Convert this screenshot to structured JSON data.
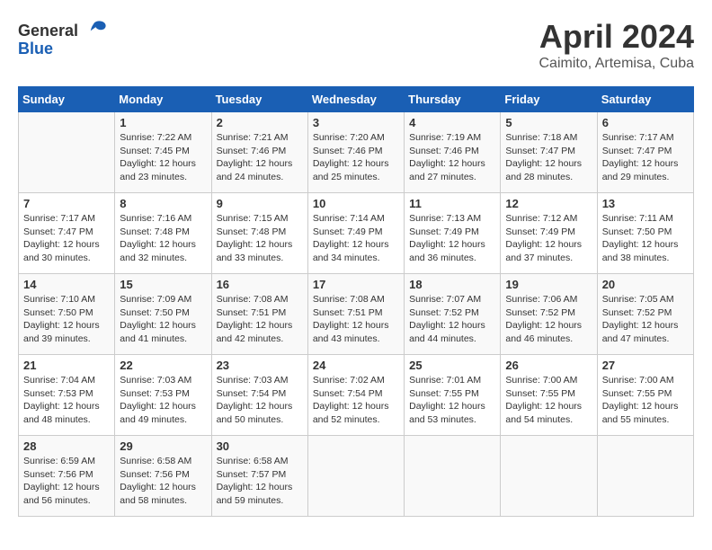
{
  "header": {
    "logo_general": "General",
    "logo_blue": "Blue",
    "month": "April 2024",
    "location": "Caimito, Artemisa, Cuba"
  },
  "calendar": {
    "days_of_week": [
      "Sunday",
      "Monday",
      "Tuesday",
      "Wednesday",
      "Thursday",
      "Friday",
      "Saturday"
    ],
    "weeks": [
      [
        {
          "day": "",
          "info": ""
        },
        {
          "day": "1",
          "info": "Sunrise: 7:22 AM\nSunset: 7:45 PM\nDaylight: 12 hours\nand 23 minutes."
        },
        {
          "day": "2",
          "info": "Sunrise: 7:21 AM\nSunset: 7:46 PM\nDaylight: 12 hours\nand 24 minutes."
        },
        {
          "day": "3",
          "info": "Sunrise: 7:20 AM\nSunset: 7:46 PM\nDaylight: 12 hours\nand 25 minutes."
        },
        {
          "day": "4",
          "info": "Sunrise: 7:19 AM\nSunset: 7:46 PM\nDaylight: 12 hours\nand 27 minutes."
        },
        {
          "day": "5",
          "info": "Sunrise: 7:18 AM\nSunset: 7:47 PM\nDaylight: 12 hours\nand 28 minutes."
        },
        {
          "day": "6",
          "info": "Sunrise: 7:17 AM\nSunset: 7:47 PM\nDaylight: 12 hours\nand 29 minutes."
        }
      ],
      [
        {
          "day": "7",
          "info": "Sunrise: 7:17 AM\nSunset: 7:47 PM\nDaylight: 12 hours\nand 30 minutes."
        },
        {
          "day": "8",
          "info": "Sunrise: 7:16 AM\nSunset: 7:48 PM\nDaylight: 12 hours\nand 32 minutes."
        },
        {
          "day": "9",
          "info": "Sunrise: 7:15 AM\nSunset: 7:48 PM\nDaylight: 12 hours\nand 33 minutes."
        },
        {
          "day": "10",
          "info": "Sunrise: 7:14 AM\nSunset: 7:49 PM\nDaylight: 12 hours\nand 34 minutes."
        },
        {
          "day": "11",
          "info": "Sunrise: 7:13 AM\nSunset: 7:49 PM\nDaylight: 12 hours\nand 36 minutes."
        },
        {
          "day": "12",
          "info": "Sunrise: 7:12 AM\nSunset: 7:49 PM\nDaylight: 12 hours\nand 37 minutes."
        },
        {
          "day": "13",
          "info": "Sunrise: 7:11 AM\nSunset: 7:50 PM\nDaylight: 12 hours\nand 38 minutes."
        }
      ],
      [
        {
          "day": "14",
          "info": "Sunrise: 7:10 AM\nSunset: 7:50 PM\nDaylight: 12 hours\nand 39 minutes."
        },
        {
          "day": "15",
          "info": "Sunrise: 7:09 AM\nSunset: 7:50 PM\nDaylight: 12 hours\nand 41 minutes."
        },
        {
          "day": "16",
          "info": "Sunrise: 7:08 AM\nSunset: 7:51 PM\nDaylight: 12 hours\nand 42 minutes."
        },
        {
          "day": "17",
          "info": "Sunrise: 7:08 AM\nSunset: 7:51 PM\nDaylight: 12 hours\nand 43 minutes."
        },
        {
          "day": "18",
          "info": "Sunrise: 7:07 AM\nSunset: 7:52 PM\nDaylight: 12 hours\nand 44 minutes."
        },
        {
          "day": "19",
          "info": "Sunrise: 7:06 AM\nSunset: 7:52 PM\nDaylight: 12 hours\nand 46 minutes."
        },
        {
          "day": "20",
          "info": "Sunrise: 7:05 AM\nSunset: 7:52 PM\nDaylight: 12 hours\nand 47 minutes."
        }
      ],
      [
        {
          "day": "21",
          "info": "Sunrise: 7:04 AM\nSunset: 7:53 PM\nDaylight: 12 hours\nand 48 minutes."
        },
        {
          "day": "22",
          "info": "Sunrise: 7:03 AM\nSunset: 7:53 PM\nDaylight: 12 hours\nand 49 minutes."
        },
        {
          "day": "23",
          "info": "Sunrise: 7:03 AM\nSunset: 7:54 PM\nDaylight: 12 hours\nand 50 minutes."
        },
        {
          "day": "24",
          "info": "Sunrise: 7:02 AM\nSunset: 7:54 PM\nDaylight: 12 hours\nand 52 minutes."
        },
        {
          "day": "25",
          "info": "Sunrise: 7:01 AM\nSunset: 7:55 PM\nDaylight: 12 hours\nand 53 minutes."
        },
        {
          "day": "26",
          "info": "Sunrise: 7:00 AM\nSunset: 7:55 PM\nDaylight: 12 hours\nand 54 minutes."
        },
        {
          "day": "27",
          "info": "Sunrise: 7:00 AM\nSunset: 7:55 PM\nDaylight: 12 hours\nand 55 minutes."
        }
      ],
      [
        {
          "day": "28",
          "info": "Sunrise: 6:59 AM\nSunset: 7:56 PM\nDaylight: 12 hours\nand 56 minutes."
        },
        {
          "day": "29",
          "info": "Sunrise: 6:58 AM\nSunset: 7:56 PM\nDaylight: 12 hours\nand 58 minutes."
        },
        {
          "day": "30",
          "info": "Sunrise: 6:58 AM\nSunset: 7:57 PM\nDaylight: 12 hours\nand 59 minutes."
        },
        {
          "day": "",
          "info": ""
        },
        {
          "day": "",
          "info": ""
        },
        {
          "day": "",
          "info": ""
        },
        {
          "day": "",
          "info": ""
        }
      ]
    ]
  }
}
